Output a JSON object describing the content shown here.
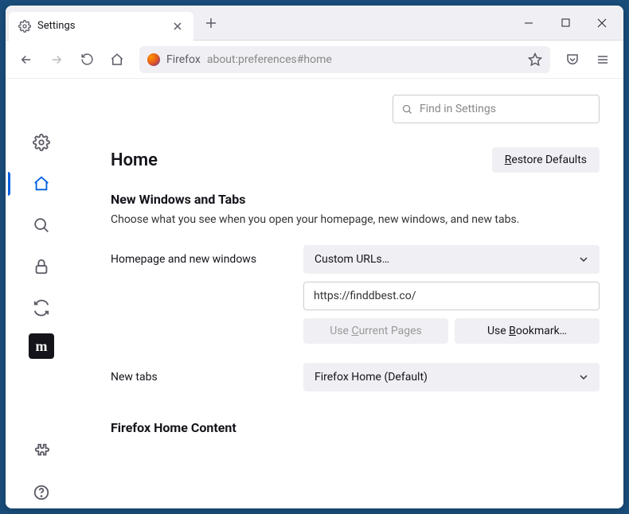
{
  "tab": {
    "title": "Settings"
  },
  "urlbar": {
    "label": "Firefox",
    "url": "about:preferences#home"
  },
  "search": {
    "placeholder": "Find in Settings"
  },
  "page": {
    "title": "Home",
    "restore_button": "Restore Defaults",
    "restore_accesskey": "R"
  },
  "section": {
    "title": "New Windows and Tabs",
    "desc": "Choose what you see when you open your homepage, new windows, and new tabs."
  },
  "homepage": {
    "label": "Homepage and new windows",
    "select_value": "Custom URLs…",
    "url_value": "https://finddbest.co/",
    "use_current": "Use Current Pages",
    "use_current_accesskey": "C",
    "use_bookmark": "Use Bookmark…",
    "use_bookmark_accesskey": "B"
  },
  "newtabs": {
    "label": "New tabs",
    "select_value": "Firefox Home (Default)"
  },
  "section2": {
    "title": "Firefox Home Content"
  }
}
